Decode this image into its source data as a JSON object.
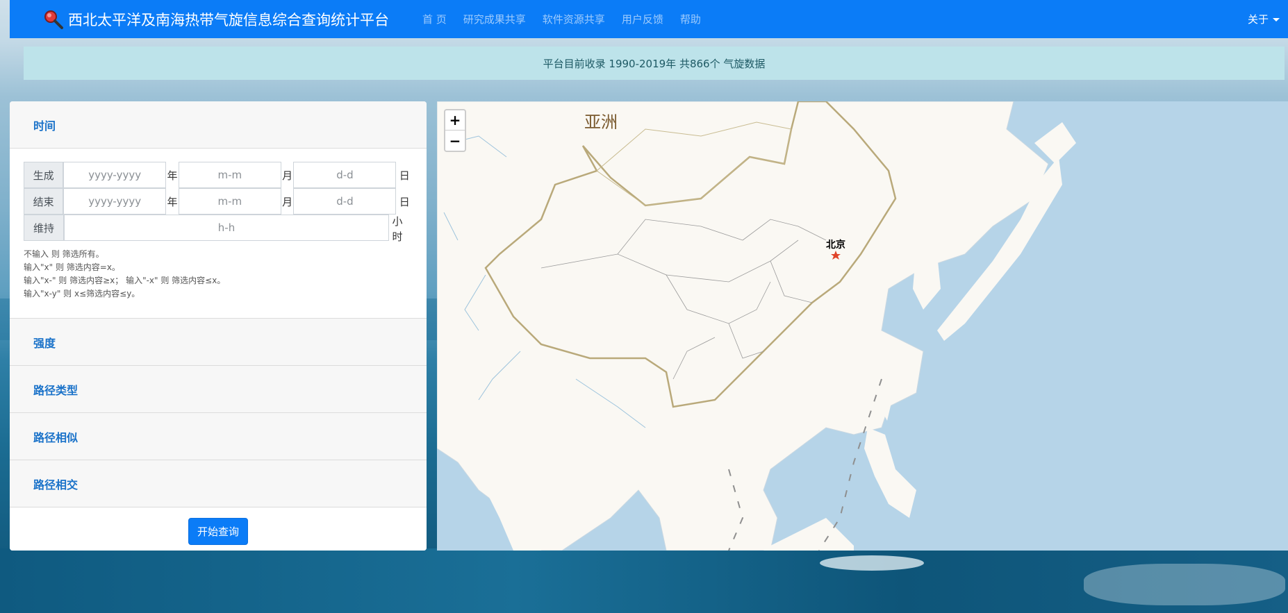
{
  "navbar": {
    "title": "西北太平洋及南海热带气旋信息综合查询统计平台",
    "links": [
      "首 页",
      "研究成果共享",
      "软件资源共享",
      "用户反馈",
      "帮助"
    ],
    "about": "关于"
  },
  "banner": {
    "text": "平台目前收录 1990-2019年 共866个 气旋数据"
  },
  "filters": {
    "time": {
      "title": "时间",
      "start_label": "生成",
      "end_label": "结束",
      "duration_label": "维持",
      "year_placeholder": "yyyy-yyyy",
      "month_placeholder": "m-m",
      "day_placeholder": "d-d",
      "hour_placeholder": "h-h",
      "unit_year": "年",
      "unit_month": "月",
      "unit_day": "日",
      "unit_hour_1": "小",
      "unit_hour_2": "时",
      "hints": [
        "不输入 则 筛选所有。",
        "输入\"x\" 则 筛选内容=x。",
        "输入\"x-\" 则 筛选内容≥x； 输入\"-x\" 则 筛选内容≤x。",
        "输入\"x-y\" 则 x≤筛选内容≤y。"
      ]
    },
    "intensity": "强度",
    "track_type": "路径类型",
    "track_similar": "路径相似",
    "track_intersect": "路径相交",
    "submit": "开始查询"
  },
  "map": {
    "zoom_in": "+",
    "zoom_out": "−",
    "continent_label": "亚洲",
    "city_label": "北京",
    "colors": {
      "water": "#b6d4e8",
      "land": "#faf8f3",
      "border": "#b9a97a",
      "marker": "#e0442a"
    }
  }
}
